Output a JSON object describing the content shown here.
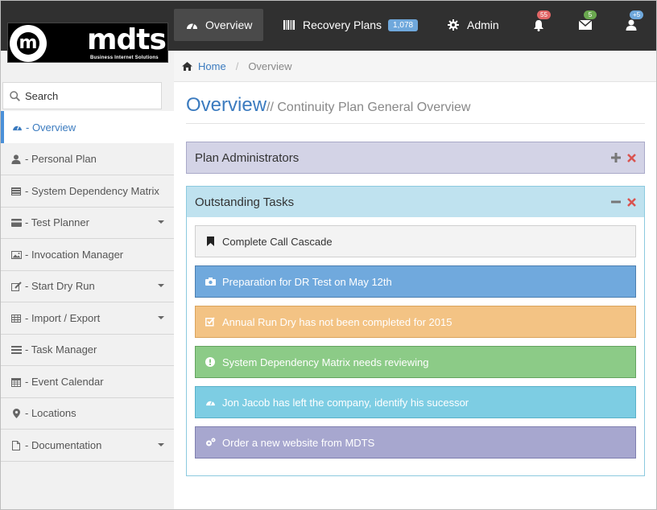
{
  "brand": {
    "logo_letter": "m",
    "name": "mdts",
    "tagline": "Business Internet Solutions"
  },
  "topnav": {
    "items": [
      {
        "label": "Overview",
        "icon": "dashboard-icon",
        "active": true
      },
      {
        "label": "Recovery Plans",
        "icon": "barcode-icon",
        "badge": "1,078"
      },
      {
        "label": "Admin",
        "icon": "gear-icon"
      }
    ],
    "notifications": {
      "icon": "bell-icon",
      "count": "55",
      "color": "#e06666"
    },
    "messages": {
      "icon": "envelope-icon",
      "count": "5",
      "color": "#6aa84f"
    },
    "user": {
      "icon": "user-icon",
      "count": "+5",
      "color": "#6fa8dc"
    }
  },
  "breadcrumb": {
    "home": "Home",
    "current": "Overview"
  },
  "sidebar": {
    "search_label": "Search",
    "items": [
      {
        "label": "- Overview",
        "icon": "dashboard-icon",
        "active": true
      },
      {
        "label": "- Personal Plan",
        "icon": "user-icon"
      },
      {
        "label": "- System Dependency Matrix",
        "icon": "list-icon"
      },
      {
        "label": "- Test Planner",
        "icon": "credit-card-icon",
        "caret": true
      },
      {
        "label": "- Invocation Manager",
        "icon": "image-icon"
      },
      {
        "label": "- Start Dry Run",
        "icon": "edit-icon",
        "caret": true
      },
      {
        "label": "- Import / Export",
        "icon": "table-icon",
        "caret": true
      },
      {
        "label": "- Task Manager",
        "icon": "tasks-icon"
      },
      {
        "label": "- Event Calendar",
        "icon": "calendar-icon"
      },
      {
        "label": "- Locations",
        "icon": "map-marker-icon"
      },
      {
        "label": "- Documentation",
        "icon": "file-icon",
        "caret": true
      }
    ]
  },
  "page": {
    "title": "Overview",
    "subtitle": "// Continuity Plan General Overview"
  },
  "panels": {
    "admins_title": "Plan Administrators",
    "tasks_title": "Outstanding Tasks"
  },
  "tasks": [
    {
      "label": "Complete Call Cascade",
      "icon": "bookmark-icon"
    },
    {
      "label": "Preparation for DR Test on May 12th",
      "icon": "camera-icon"
    },
    {
      "label": "Annual Run Dry has not been completed for 2015",
      "icon": "check-square-icon"
    },
    {
      "label": "System Dependency Matrix needs reviewing",
      "icon": "exclamation-circle-icon"
    },
    {
      "label": "Jon Jacob has left the company, identify his sucessor",
      "icon": "dashboard-icon"
    },
    {
      "label": "Order a new website from MDTS",
      "icon": "cogs-icon"
    }
  ],
  "colors": {
    "accent": "#3b7bbf",
    "topbar": "#303030",
    "close_red": "#d9534f"
  }
}
